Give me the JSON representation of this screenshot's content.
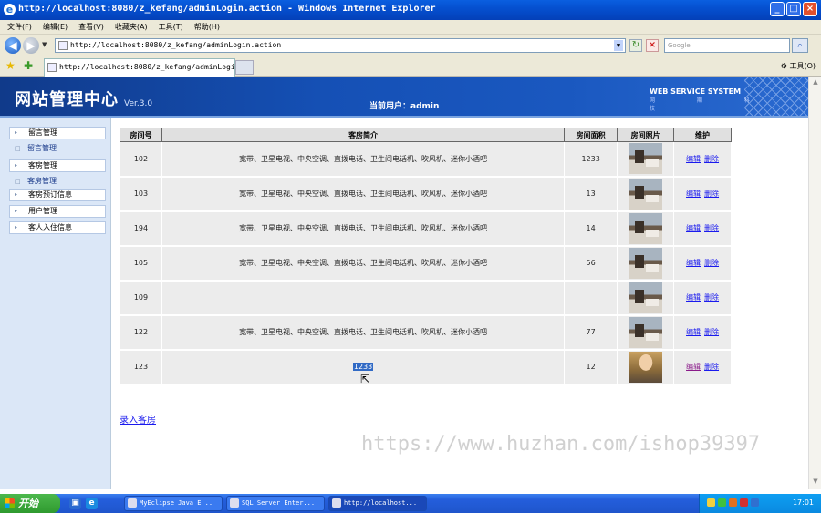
{
  "window": {
    "title": "http://localhost:8080/z_kefang/adminLogin.action - Windows Internet Explorer"
  },
  "menu": [
    "文件(F)",
    "编辑(E)",
    "查看(V)",
    "收藏夹(A)",
    "工具(T)",
    "帮助(H)"
  ],
  "address": {
    "url": "http://localhost:8080/z_kefang/adminLogin.action",
    "search_placeholder": "Google"
  },
  "tab": {
    "label": "http://localhost:8080/z_kefang/adminLogin..."
  },
  "toolbar": {
    "tools_label": "工具(O)"
  },
  "header": {
    "title": "网站管理中心",
    "version": "Ver.3.0",
    "current_user": "当前用户：admin",
    "brand": "WEB SERVICE SYSTEM",
    "brand_sub": "网 期 科 技"
  },
  "sidebar": {
    "items": [
      {
        "label": "留言管理",
        "type": "header"
      },
      {
        "label": "留言管理",
        "type": "link"
      },
      {
        "label": "客房管理",
        "type": "header"
      },
      {
        "label": "客房管理",
        "type": "link"
      },
      {
        "label": "客房预订信息",
        "type": "header"
      },
      {
        "label": "用户管理",
        "type": "header"
      },
      {
        "label": "客人入住信息",
        "type": "header"
      }
    ]
  },
  "table": {
    "columns": [
      "房间号",
      "客房简介",
      "房间面积",
      "房间照片",
      "维护"
    ],
    "rows": [
      {
        "room": "102",
        "desc": "宽带、卫星电视、中央空调、直拨电话、卫生间电话机、吹风机、迷你小酒吧",
        "area": "1233",
        "photo": "room"
      },
      {
        "room": "103",
        "desc": "宽带、卫星电视、中央空调、直拨电话、卫生间电话机、吹风机、迷你小酒吧",
        "area": "13",
        "photo": "room"
      },
      {
        "room": "194",
        "desc": "宽带、卫星电视、中央空调、直拨电话、卫生间电话机、吹风机、迷你小酒吧",
        "area": "14",
        "photo": "room"
      },
      {
        "room": "105",
        "desc": "宽带、卫星电视、中央空调、直拨电话、卫生间电话机、吹风机、迷你小酒吧",
        "area": "56",
        "photo": "room"
      },
      {
        "room": "109",
        "desc": "",
        "area": "",
        "photo": "room"
      },
      {
        "room": "122",
        "desc": "宽带、卫星电视、中央空调、直拨电话、卫生间电话机、吹风机、迷你小酒吧",
        "area": "77",
        "photo": "room"
      },
      {
        "room": "123",
        "desc": "1233",
        "area": "12",
        "photo": "person"
      }
    ],
    "edit_label": "编辑",
    "delete_label": "删除"
  },
  "add_room_label": "录入客房",
  "watermark": "https://www.huzhan.com/ishop39397",
  "taskbar": {
    "start_label": "开始",
    "tasks": [
      "MyEclipse Java E...",
      "SQL Server Enter...",
      "http://localhost..."
    ],
    "clock": "17:01"
  }
}
